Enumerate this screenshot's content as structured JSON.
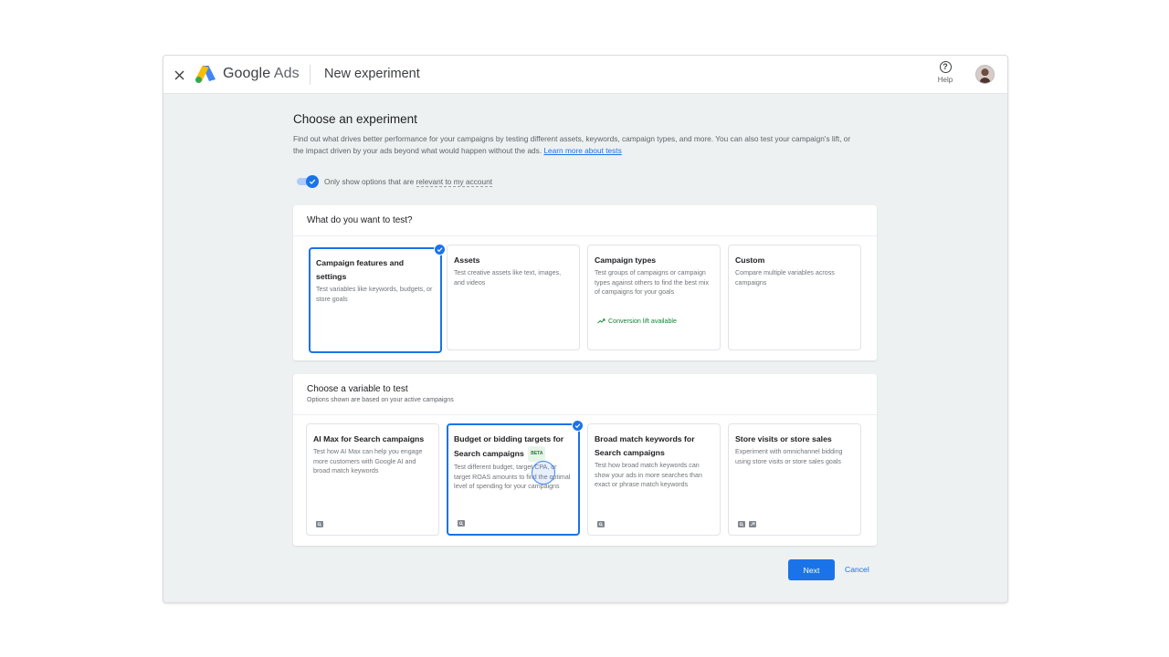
{
  "header": {
    "brand_google": "Google",
    "brand_ads": "Ads",
    "page_title": "New experiment",
    "help_label": "Help",
    "help_glyph": "?"
  },
  "intro": {
    "title": "Choose an experiment",
    "description": "Find out what drives better performance for your campaigns by testing different assets, keywords, campaign types, and more. You can also test your campaign's lift, or the impact driven by your ads beyond what would happen without the ads.",
    "learn_more": "Learn more about tests"
  },
  "filter": {
    "enabled": true,
    "label_prefix": "Only show options that are",
    "label_link": "relevant to my account"
  },
  "test_panel": {
    "title": "What do you want to test?",
    "cards": [
      {
        "title": "Campaign features and settings",
        "description": "Test variables like keywords, budgets, or store goals",
        "selected": true
      },
      {
        "title": "Assets",
        "description": "Test creative assets like text, images, and videos",
        "selected": false
      },
      {
        "title": "Campaign types",
        "description": "Test groups of campaigns or campaign types against others to find the best mix of campaigns for your goals",
        "extra": "Conversion lift available",
        "selected": false
      },
      {
        "title": "Custom",
        "description": "Compare multiple variables across campaigns",
        "selected": false
      }
    ]
  },
  "variable_panel": {
    "title": "Choose a variable to test",
    "subtitle": "Options shown are based on your active campaigns",
    "cards": [
      {
        "title": "AI Max for Search campaigns",
        "description": "Test how AI Max can help you engage more customers with Google AI and broad match keywords",
        "selected": false
      },
      {
        "title": "Budget or bidding targets for Search campaigns",
        "badge": "BETA",
        "description": "Test different budget, target CPA, or target ROAS amounts to find the optimal level of spending for your campaigns",
        "selected": true
      },
      {
        "title": "Broad match keywords for Search campaigns",
        "description": "Test how broad match keywords can show your ads in more searches than exact or phrase match keywords",
        "selected": false
      },
      {
        "title": "Store visits or store sales",
        "description": "Experiment with omnichannel bidding using store visits or store sales goals",
        "selected": false
      }
    ]
  },
  "actions": {
    "next": "Next",
    "cancel": "Cancel"
  },
  "colors": {
    "accent": "#1a73e8",
    "success": "#188038",
    "background": "#eef1f2"
  }
}
